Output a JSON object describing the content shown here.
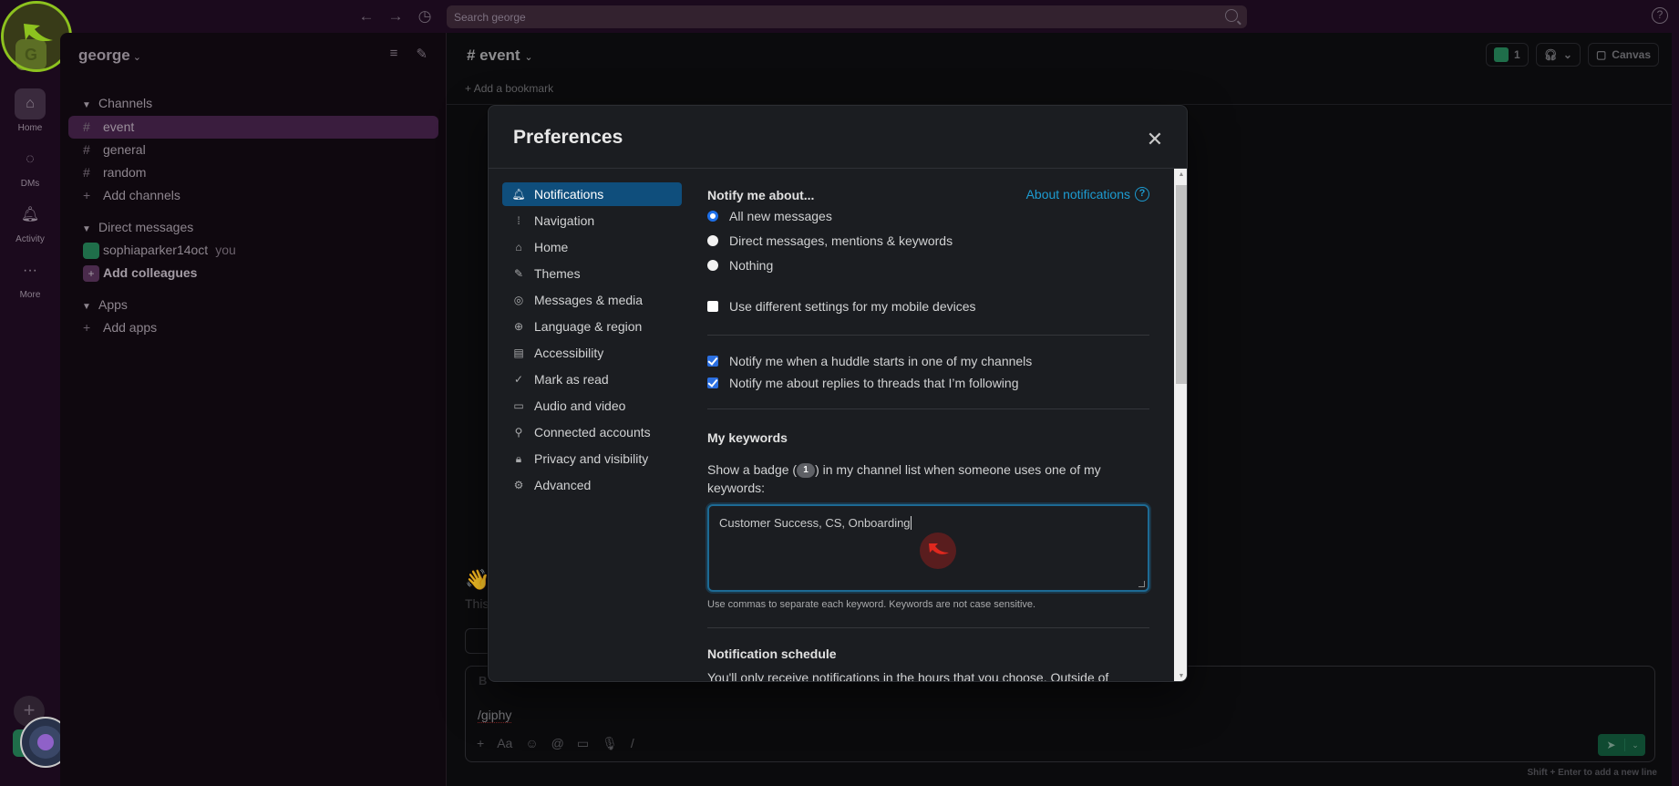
{
  "topbar": {
    "back_icon": "arrow-left-icon",
    "forward_icon": "arrow-right-icon",
    "history_icon": "clock-icon",
    "search_placeholder": "Search george",
    "help_icon": "help-icon"
  },
  "rail": {
    "workspace_initial": "G",
    "items": [
      {
        "label": "Home",
        "icon": "home-icon"
      },
      {
        "label": "DMs",
        "icon": "dms-icon"
      },
      {
        "label": "Activity",
        "icon": "bell-icon"
      },
      {
        "label": "More",
        "icon": "more-icon"
      }
    ]
  },
  "sidebar": {
    "workspace_name": "george",
    "channels_header": "Channels",
    "channels": [
      {
        "name": "event",
        "active": true
      },
      {
        "name": "general",
        "active": false
      },
      {
        "name": "random",
        "active": false
      }
    ],
    "add_channels": "Add channels",
    "dm_header": "Direct messages",
    "dm_user": "sophiaparker14oct",
    "dm_you": "you",
    "add_colleagues": "Add colleagues",
    "apps_header": "Apps",
    "add_apps": "Add apps"
  },
  "main": {
    "channel_title": "# event",
    "add_bookmark": "Add a bookmark",
    "members_count": "1",
    "canvas_label": "Canvas",
    "intro_text": "This",
    "composer_text": "/giphy",
    "composer_tools": [
      "+",
      "Aa",
      "☺",
      "@",
      "▭",
      "🎙",
      "/"
    ],
    "hint": "Shift + Enter to add a new line"
  },
  "modal": {
    "title": "Preferences",
    "nav": [
      {
        "label": "Notifications",
        "icon": "bell-icon",
        "glyph": "🔔︎",
        "active": true
      },
      {
        "label": "Navigation",
        "icon": "navigation-icon",
        "glyph": "⁞",
        "active": false
      },
      {
        "label": "Home",
        "icon": "home-icon",
        "glyph": "⌂",
        "active": false
      },
      {
        "label": "Themes",
        "icon": "brush-icon",
        "glyph": "✎",
        "active": false
      },
      {
        "label": "Messages & media",
        "icon": "message-icon",
        "glyph": "◎",
        "active": false
      },
      {
        "label": "Language & region",
        "icon": "globe-icon",
        "glyph": "⊕",
        "active": false
      },
      {
        "label": "Accessibility",
        "icon": "accessibility-icon",
        "glyph": "▤",
        "active": false
      },
      {
        "label": "Mark as read",
        "icon": "check-circle-icon",
        "glyph": "✓",
        "active": false
      },
      {
        "label": "Audio and video",
        "icon": "video-icon",
        "glyph": "▭",
        "active": false
      },
      {
        "label": "Connected accounts",
        "icon": "link-icon",
        "glyph": "⚲",
        "active": false
      },
      {
        "label": "Privacy and visibility",
        "icon": "lock-icon",
        "glyph": "🔒︎",
        "active": false
      },
      {
        "label": "Advanced",
        "icon": "gear-icon",
        "glyph": "⚙",
        "active": false
      }
    ],
    "notify_title": "Notify me about...",
    "about_link": "About notifications",
    "notify_options": [
      {
        "label": "All new messages",
        "selected": true
      },
      {
        "label": "Direct messages, mentions & keywords",
        "selected": false
      },
      {
        "label": "Nothing",
        "selected": false
      }
    ],
    "mobile_option": {
      "label": "Use different settings for my mobile devices",
      "checked": false
    },
    "huddle_option": {
      "label": "Notify me when a huddle starts in one of my channels",
      "checked": true
    },
    "threads_option": {
      "label": "Notify me about replies to threads that I’m following",
      "checked": true
    },
    "keywords_title": "My keywords",
    "keywords_desc_before": "Show a badge (",
    "keywords_badge": "1",
    "keywords_desc_after": ") in my channel list when someone uses one of my keywords:",
    "keywords_value": "Customer Success, CS, Onboarding",
    "keywords_helper": "Use commas to separate each keyword. Keywords are not case sensitive.",
    "schedule_title": "Notification schedule",
    "schedule_text": "You'll only receive notifications in the hours that you choose. Outside of"
  },
  "colors": {
    "active_nav": "#0f4e7c",
    "link": "#1d9bd1",
    "checkbox": "#2b6fe0",
    "focus_ring": "#1d6a94",
    "highlight_ring": "#8dc21f",
    "click_marker": "#e0281e"
  }
}
